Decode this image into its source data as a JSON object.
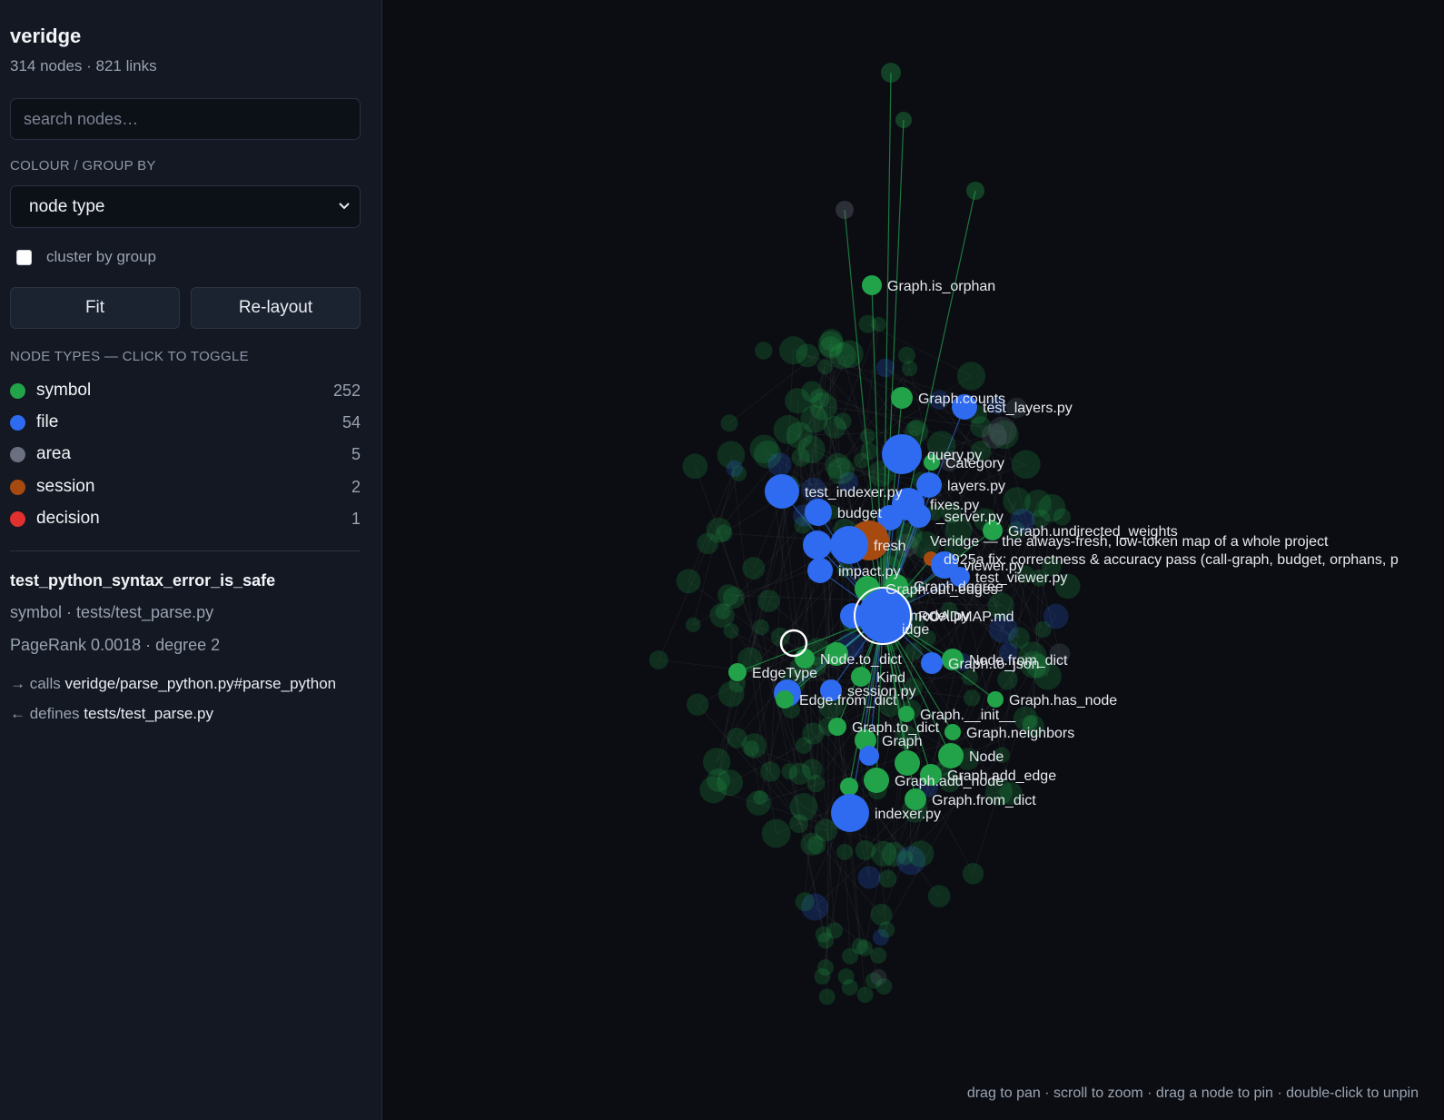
{
  "app": {
    "title": "veridge",
    "stats": "314 nodes · 821 links"
  },
  "search": {
    "placeholder": "search nodes…",
    "value": ""
  },
  "group_by": {
    "label": "COLOUR / GROUP BY",
    "selected": "node type"
  },
  "cluster": {
    "label": "cluster by group",
    "checked": false
  },
  "buttons": {
    "fit": "Fit",
    "relayout": "Re-layout"
  },
  "legend": {
    "label": "NODE TYPES — CLICK TO TOGGLE",
    "items": [
      {
        "name": "symbol",
        "count": "252",
        "color": "#22a34a"
      },
      {
        "name": "file",
        "count": "54",
        "color": "#2f6bf0"
      },
      {
        "name": "area",
        "count": "5",
        "color": "#6b7080"
      },
      {
        "name": "session",
        "count": "2",
        "color": "#a64a10"
      },
      {
        "name": "decision",
        "count": "1",
        "color": "#e03030"
      }
    ]
  },
  "detail": {
    "title": "test_python_syntax_error_is_safe",
    "meta": "symbol · tests/test_parse.py",
    "metrics": "PageRank 0.0018 · degree 2",
    "calls_prefix": "→ calls",
    "calls_target": "veridge/parse_python.py#parse_python",
    "defines_prefix": "← defines",
    "defines_target": "tests/test_parse.py"
  },
  "graph": {
    "hint": "drag to pan · scroll to zoom · drag a node to pin · double-click to unpin",
    "labels": [
      "Graph.is_orphan",
      "Graph.counts",
      "test_layers.py",
      "query.py",
      "Category",
      "layers.py",
      "test_indexer.py",
      "budget",
      "fixes.py",
      "_server.py",
      "Graph.undirected_weights",
      "Veridge — the always-fresh, low-token map of a whole project",
      "d925a fix: correctness & accuracy pass (call-graph, budget, orphans, p",
      "viewer.py",
      "impact.py",
      "test_viewer.py",
      "Graph.out_edges",
      "Graph.degree",
      "ROADMAP.md",
      "model.py",
      "idge",
      "Node.to_dict",
      "Node.from_dict",
      "EdgeType",
      "Graph.to_json",
      "Kind",
      "session.py",
      "Edge.from_dict",
      "Graph.has_node",
      "Graph.__init__",
      "Graph.to_dict",
      "Graph.neighbors",
      "Graph",
      "Node",
      "Graph.add_edge",
      "Graph.add_node",
      "Graph.from_dict",
      "indexer.py",
      "fresh"
    ]
  }
}
